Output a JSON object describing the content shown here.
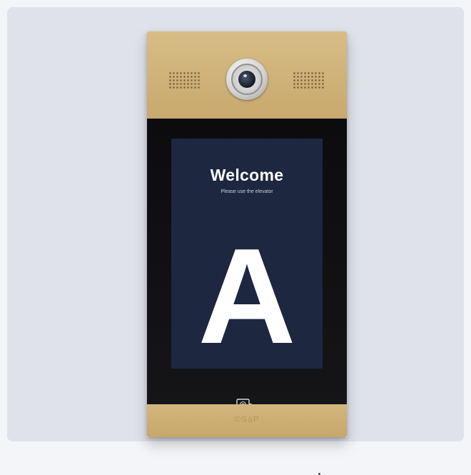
{
  "screen": {
    "title": "Welcome",
    "subtitle": "Please use the elevator",
    "letter": "A"
  },
  "device": {
    "brand": "©SaP"
  },
  "icons": {
    "camera": "camera-lens",
    "speakers": "speaker-grille",
    "card_reader": "nfc-card-icon"
  },
  "colors": {
    "panel_gold": "#c8a96e",
    "glass": "#111113",
    "screen_bg": "#1d2740",
    "backdrop": "#dfe2ea"
  }
}
